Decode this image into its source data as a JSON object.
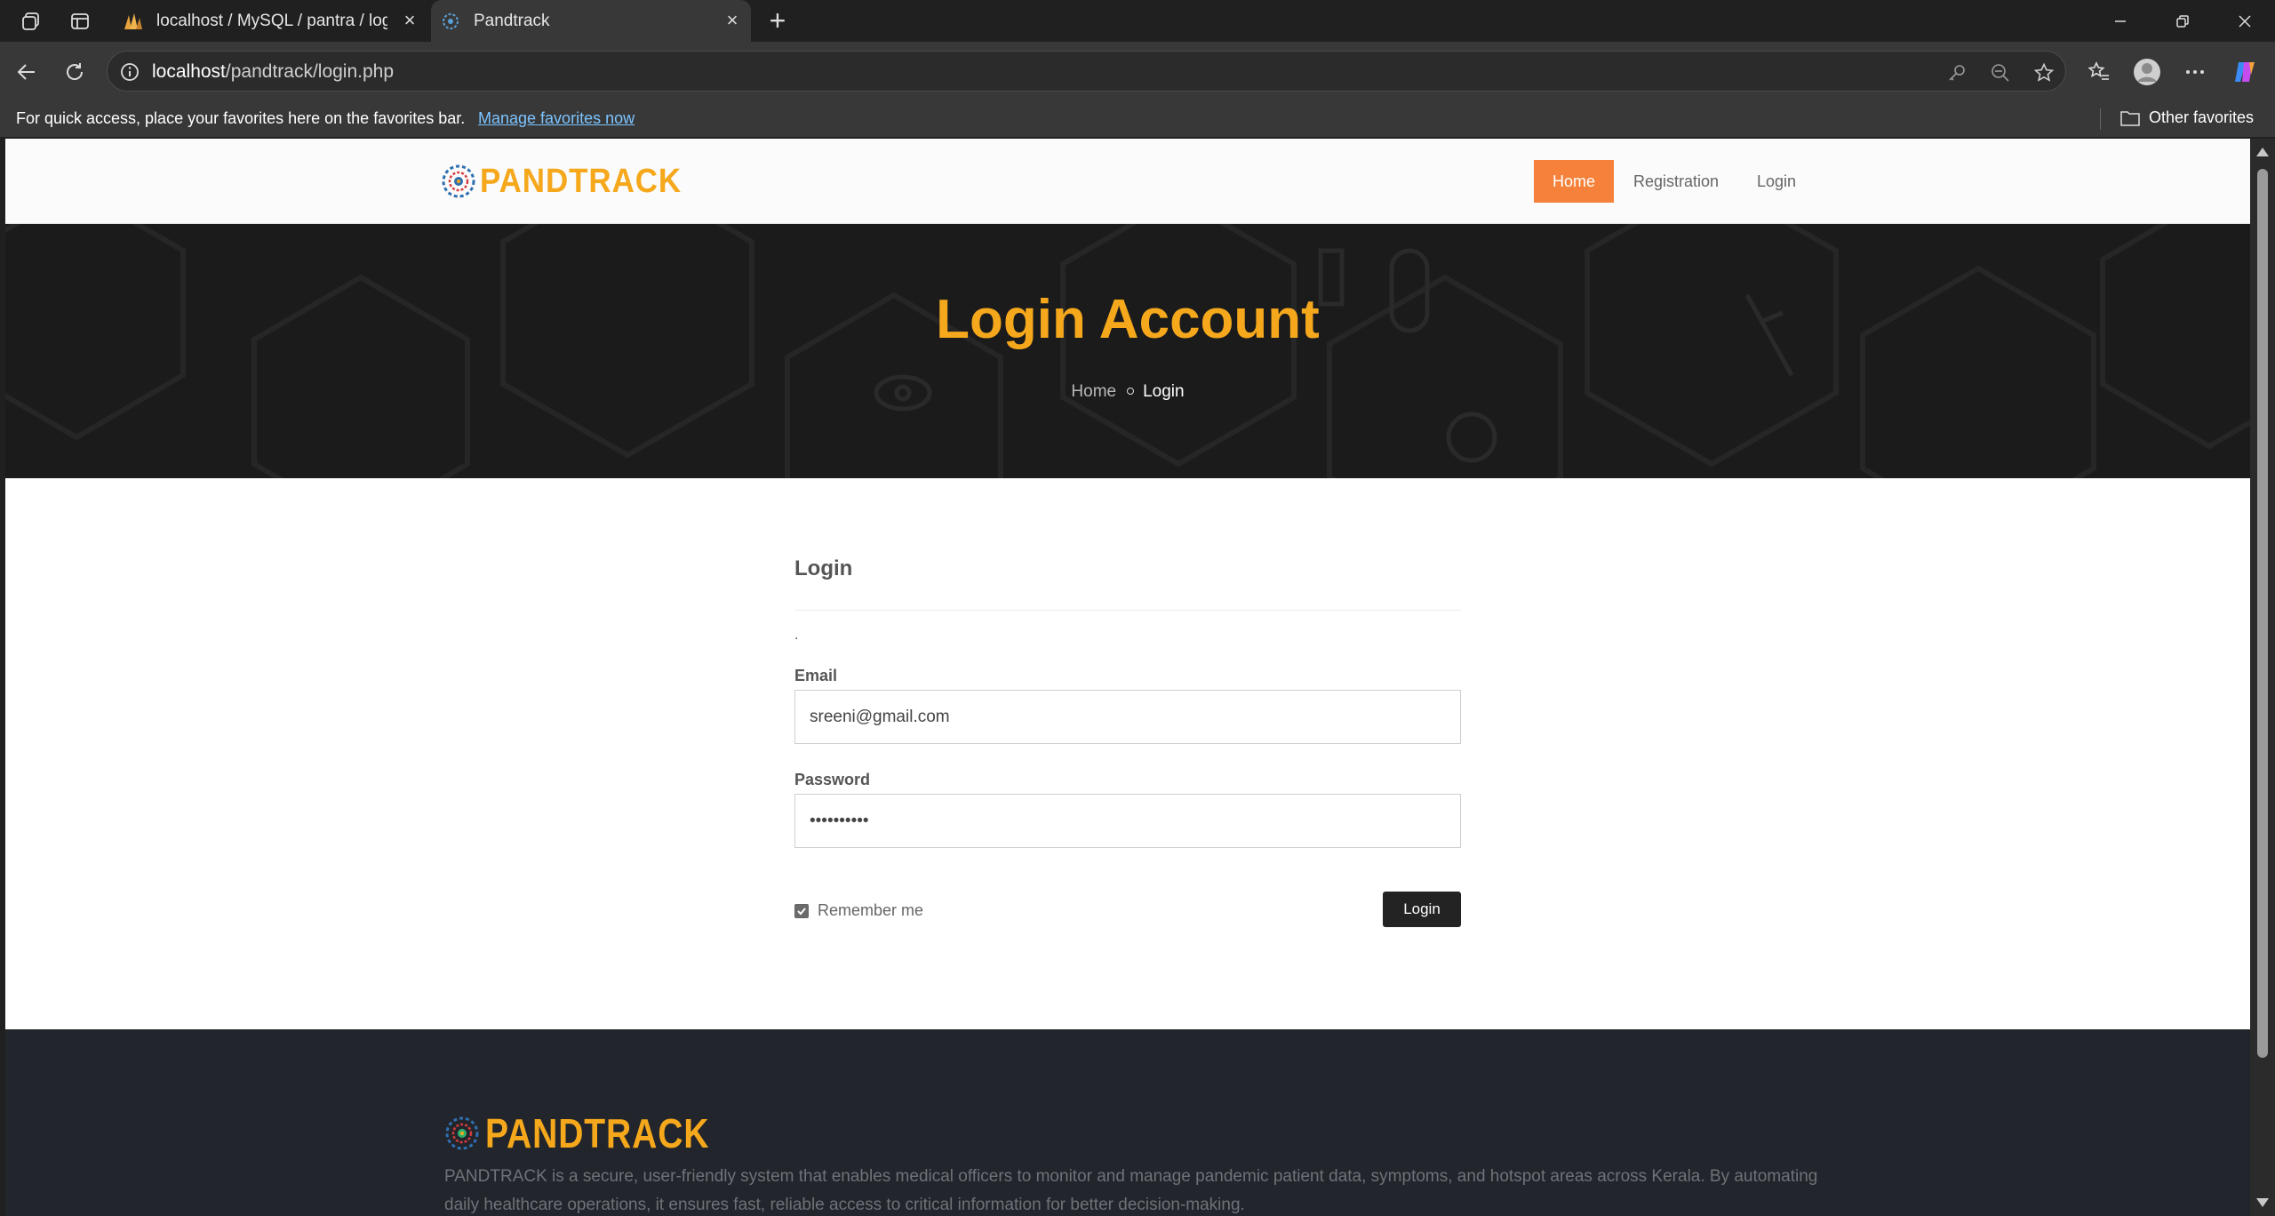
{
  "browser": {
    "tabs": [
      {
        "title": "localhost / MySQL / pantra / logi",
        "active": false
      },
      {
        "title": "Pandtrack",
        "active": true
      }
    ],
    "address_url_host": "localhost",
    "address_url_path": "/pandtrack/login.php",
    "favorites_bar_message": "For quick access, place your favorites here on the favorites bar.",
    "favorites_bar_link": "Manage favorites now",
    "other_favorites": "Other favorites"
  },
  "site": {
    "logo_text": "PANDTRACK",
    "nav": {
      "home": "Home",
      "registration": "Registration",
      "login": "Login"
    },
    "accent_color": "#f5a81c",
    "nav_active_color": "#f5813a"
  },
  "hero": {
    "title": "Login Account",
    "breadcrumb_home": "Home",
    "breadcrumb_current": "Login"
  },
  "form": {
    "heading": "Login",
    "notice": ".",
    "email_label": "Email",
    "email_value": "sreeni@gmail.com",
    "password_label": "Password",
    "password_value": "••••••••••",
    "remember_label": "Remember me",
    "remember_checked": true,
    "submit_label": "Login"
  },
  "footer": {
    "logo_text": "PANDTRACK",
    "description": "PANDTRACK is a secure, user-friendly system that enables medical officers to monitor and manage pandemic patient data, symptoms, and hotspot areas across Kerala. By automating daily healthcare operations, it ensures fast, reliable access to critical information for better decision-making."
  }
}
